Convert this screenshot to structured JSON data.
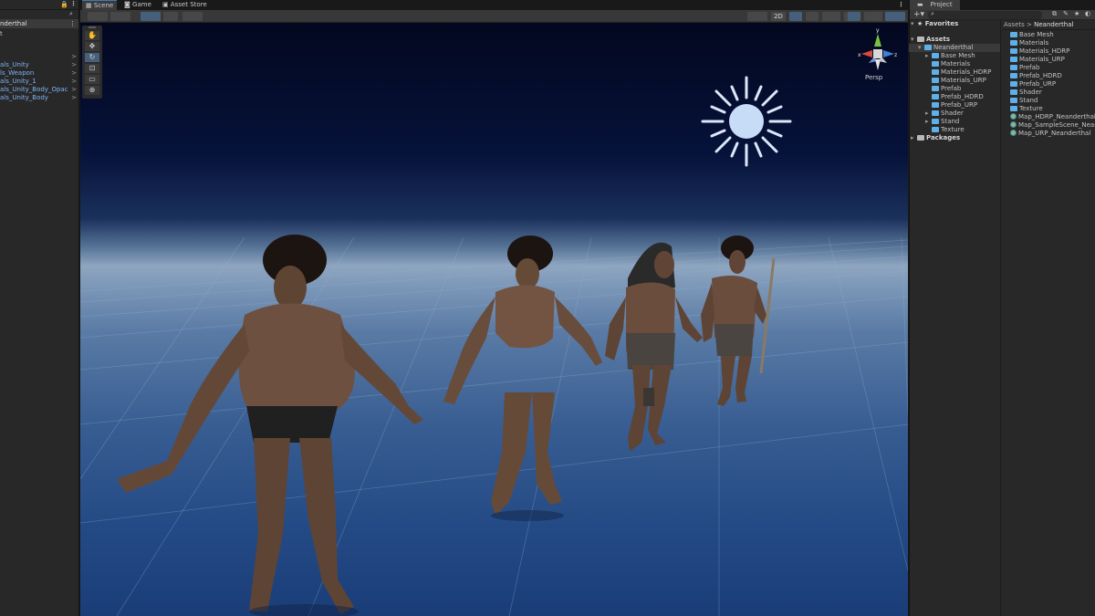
{
  "hierarchy": {
    "selected": "nderthal",
    "items": [
      {
        "label": "als_Unity",
        "arrow": ">"
      },
      {
        "label": "ls_Weapon",
        "arrow": ">"
      },
      {
        "label": "als_Unity_1",
        "arrow": ">"
      },
      {
        "label": "als_Unity_Body_Opac",
        "arrow": ">"
      },
      {
        "label": "als_Unity_Body",
        "arrow": ">"
      }
    ],
    "stub": "t"
  },
  "tabs": {
    "scene": "Scene",
    "game": "Game",
    "asset_store": "Asset Store"
  },
  "toolbar": {
    "btn_2d": "2D"
  },
  "gizmo": {
    "persp": "Persp",
    "x": "x",
    "z": "z",
    "y": "y"
  },
  "project": {
    "tab": "Project",
    "favorites": "Favorites",
    "assets": "Assets",
    "packages": "Packages",
    "tree": [
      {
        "label": "Neanderthal",
        "level": 1,
        "selected": true
      },
      {
        "label": "Base Mesh",
        "level": 2,
        "caret": true
      },
      {
        "label": "Materials",
        "level": 2
      },
      {
        "label": "Materials_HDRP",
        "level": 2
      },
      {
        "label": "Materials_URP",
        "level": 2
      },
      {
        "label": "Prefab",
        "level": 2
      },
      {
        "label": "Prefab_HDRD",
        "level": 2
      },
      {
        "label": "Prefab_URP",
        "level": 2
      },
      {
        "label": "Shader",
        "level": 2,
        "caret": true
      },
      {
        "label": "Stand",
        "level": 2,
        "caret": true
      },
      {
        "label": "Texture",
        "level": 2
      }
    ],
    "breadcrumb": {
      "root": "Assets",
      "sep": ">",
      "current": "Neanderthal"
    },
    "list": [
      {
        "label": "Base Mesh",
        "kind": "folder"
      },
      {
        "label": "Materials",
        "kind": "folder"
      },
      {
        "label": "Materials_HDRP",
        "kind": "folder"
      },
      {
        "label": "Materials_URP",
        "kind": "folder"
      },
      {
        "label": "Prefab",
        "kind": "folder"
      },
      {
        "label": "Prefab_HDRD",
        "kind": "folder"
      },
      {
        "label": "Prefab_URP",
        "kind": "folder"
      },
      {
        "label": "Shader",
        "kind": "folder"
      },
      {
        "label": "Stand",
        "kind": "folder"
      },
      {
        "label": "Texture",
        "kind": "folder"
      },
      {
        "label": "Map_HDRP_Neanderthal",
        "kind": "scene"
      },
      {
        "label": "Map_SampleScene_Neanderthal",
        "kind": "scene"
      },
      {
        "label": "Map_URP_Neanderthal",
        "kind": "scene"
      }
    ]
  },
  "colors": {
    "accent": "#3a79bb",
    "panel": "#282828",
    "toolbar": "#383838",
    "link": "#7fb4f5"
  }
}
